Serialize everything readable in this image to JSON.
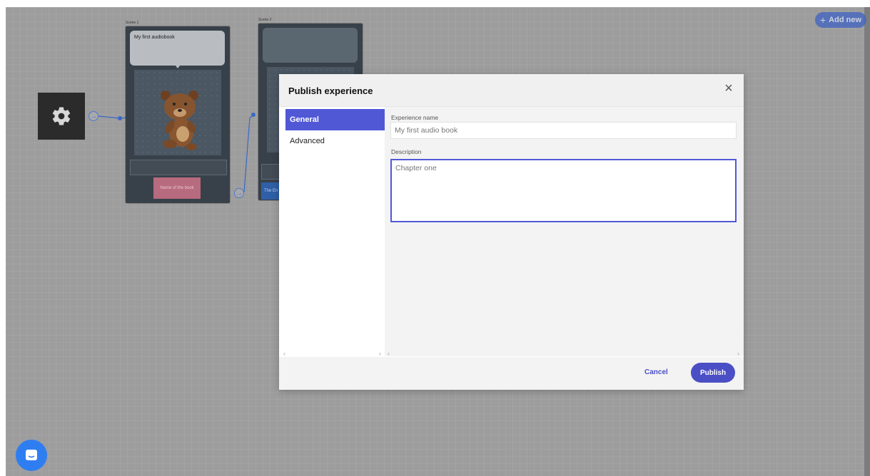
{
  "toolbar": {
    "add_new_label": "Add new",
    "add_new_icon": "plus-icon"
  },
  "scenes": [
    {
      "label": "Scene 1",
      "bubble_text": "My first audiobook",
      "button_text": "Name of the book"
    },
    {
      "label": "Scene 2",
      "bubble_text": "",
      "button_text": "The En"
    }
  ],
  "modal": {
    "title": "Publish experience",
    "tabs": [
      {
        "label": "General",
        "active": true
      },
      {
        "label": "Advanced",
        "active": false
      }
    ],
    "fields": {
      "experience_name_label": "Experience name",
      "experience_name_value": "My first audio book",
      "description_label": "Description",
      "description_value": "Chapter one"
    },
    "cancel_label": "Cancel",
    "publish_label": "Publish"
  },
  "colors": {
    "accent": "#5058d6",
    "button": "#4b4fc5",
    "chat": "#2f7ef1"
  }
}
